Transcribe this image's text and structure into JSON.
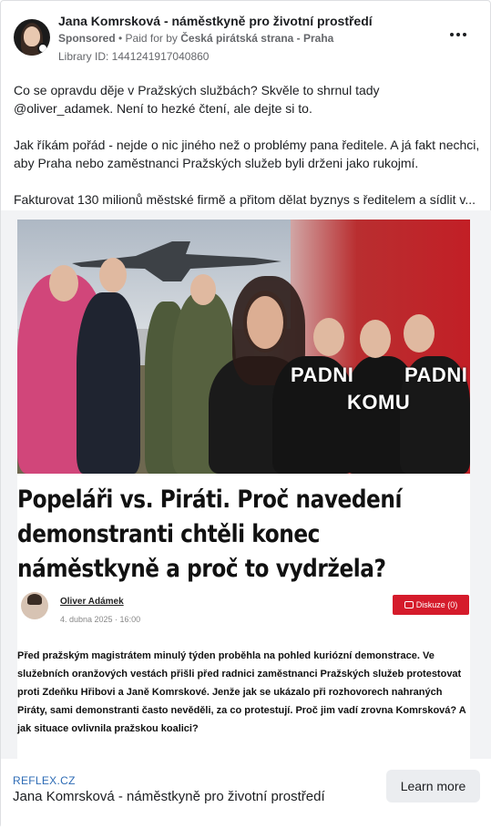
{
  "post": {
    "page_name": "Jana Komrsková - náměstkyně pro životní prostředí",
    "sponsored": "Sponsored",
    "paid_for_prefix": "• Paid for by ",
    "paid_for_by": "Česká pirátská strana - Praha",
    "library_id": "Library ID: 1441241917040860",
    "more_icon": "more-horizontal-icon",
    "paragraphs": [
      "Co se opravdu děje v Pražských službách? Skvěle to shrnul tady @oliver_adamek. Není to hezké čtení, ale dejte si to.",
      "Jak říkám pořád - nejde o nic jiného než o problémy pana ředitele. A já fakt nechci, aby Praha nebo zaměstnanci Pražských služeb byli drženi jako rukojmí.",
      "Fakturovat 130 milionů městské firmě a přitom dělat byznys s ředitelem a sídlit v..."
    ]
  },
  "media": {
    "overlay_words": [
      "PADNI",
      "KOMU",
      "PADNI"
    ],
    "article": {
      "headline": "Popeláři vs. Piráti. Proč navedení demonstranti chtěli konec náměstkyně a proč to vydržela?",
      "author": "Oliver Adámek",
      "date": "4. dubna 2025 · 16:00",
      "discussion_label": "Diskuze (0)",
      "lead": "Před pražským magistrátem minulý týden proběhla na pohled kuriózní demonstrace. Ve služebních oranžových vestách přišli před radnici zaměstnanci Pražských služeb protestovat proti Zdeňku Hřibovi a Janě Komrskové. Jenže jak se ukázalo při rozhovorech nahraných Piráty, sami demonstranti často nevěděli, za co protestují. Proč jim vadí zrovna Komrsková? A jak situace ovlivnila pražskou koalici?"
    }
  },
  "footer": {
    "domain": "REFLEX.CZ",
    "title": "Jana Komrsková - náměstkyně pro životní prostředí",
    "cta": "Learn more"
  },
  "colors": {
    "link": "#2d6bb5",
    "button_bg": "#ebedf0",
    "discussion_red": "#d51b2b"
  }
}
